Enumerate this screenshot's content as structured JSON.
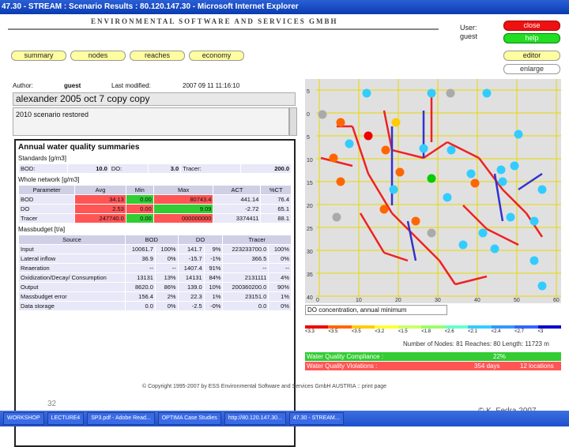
{
  "window_title": "47.30 - STREAM : Scenario Results : 80.120.147.30 - Microsoft Internet Explorer",
  "logo": "ENVIRONMENTAL SOFTWARE AND SERVICES GMBH",
  "user_label": "User:",
  "user_name": "guest",
  "buttons": {
    "close": "close",
    "help": "help",
    "editor": "editor",
    "enlarge": "enlarge",
    "summary": "summary",
    "nodes": "nodes",
    "reaches": "reaches",
    "economy": "economy"
  },
  "meta": {
    "author_label": "Author:",
    "author": "guest",
    "modified_label": "Last modified:",
    "modified": "2007 09 11 11:16:10"
  },
  "scenario_name": "alexander 2005 oct 7 copy copy",
  "scenario_desc": "2010 scenario restored",
  "summary": {
    "title": "Annual water quality summaries",
    "standards_label": "Standards [g/m3]",
    "standards": [
      [
        "BOD:",
        "10.0"
      ],
      [
        "DO:",
        "3.0"
      ],
      [
        "Tracer:",
        "200.0"
      ]
    ],
    "whole_label": "Whole network [g/m3]",
    "whole_headers": [
      "Parameter",
      "Avg",
      "Min",
      "Max",
      "ACT",
      "%CT"
    ],
    "whole_rows": [
      [
        "BOD",
        "34.13",
        "0.00",
        "80743.4",
        "441.14",
        "76.4"
      ],
      [
        "DO",
        "2.53",
        "0.00",
        "9.09",
        "-2.72",
        "65.1"
      ],
      [
        "Tracer",
        "247740.0",
        "0.00",
        "000000000",
        "3374411",
        "88.1"
      ]
    ],
    "mass_label": "Massbudget [t/a]",
    "mass_headers": [
      "Source",
      "BOD",
      "",
      "DO",
      "",
      "Tracer"
    ],
    "mass_rows": [
      [
        "Input",
        "10061.7",
        "100%",
        "141.7",
        "9%",
        "223233700.0",
        "100%"
      ],
      [
        "Lateral inflow",
        "36.9",
        "0%",
        "-15.7",
        "-1%",
        "366.5",
        "0%"
      ],
      [
        "Reaeration",
        "--",
        "--",
        "1407.4",
        "91%",
        "--",
        "--"
      ],
      [
        "Oxidization/Decay/ Consumption",
        "13131",
        "13%",
        "14131",
        "84%",
        "2131111",
        "4%"
      ],
      [
        "Output",
        "8620.0",
        "86%",
        "139.0",
        "10%",
        "200360200.0",
        "90%"
      ],
      [
        "Massbudget error",
        "156.4",
        "2%",
        "22.3",
        "1%",
        "23151.0",
        "1%"
      ],
      [
        "Data storage",
        "0.0",
        "0%",
        "-2.5",
        "-0%",
        "0.0",
        "0%"
      ]
    ]
  },
  "plot": {
    "yticks": [
      "5",
      "0",
      "5",
      "10",
      "15",
      "20",
      "25",
      "30",
      "35",
      "40"
    ],
    "xticks": [
      "0",
      "10",
      "20",
      "30",
      "40",
      "50",
      "60"
    ]
  },
  "dropdown": "DO concentration, annual minimum",
  "legend": [
    "<3.3",
    "<3.5",
    "<3.5",
    "<3.2",
    "<1.5",
    "<1.8",
    "<2.6",
    "<2.1",
    "<2.4",
    "<2.7",
    "<3"
  ],
  "nodes_line": "Number of Nodes: 81 Reaches: 80 Length: 11723 m",
  "compliance_label": "Water Quality Compliance :",
  "compliance_val": "22%",
  "violations_label": "Water Quality Violations :",
  "violations_val": "354 days",
  "violations_extra": "12 locations",
  "footer": "© Copyright 1995-2007 by ESS Environmental Software and Services GmbH AUSTRIA :: print page",
  "page_no": "32",
  "credit": "© K. Fedra 2007",
  "taskbar": [
    "WORKSHOP",
    "LECTURE4",
    "SP3.pdf - Adobe Read...",
    "OPTIMA Case Studies",
    "http://80.120.147.30...",
    "47.30 - STREAM..."
  ]
}
